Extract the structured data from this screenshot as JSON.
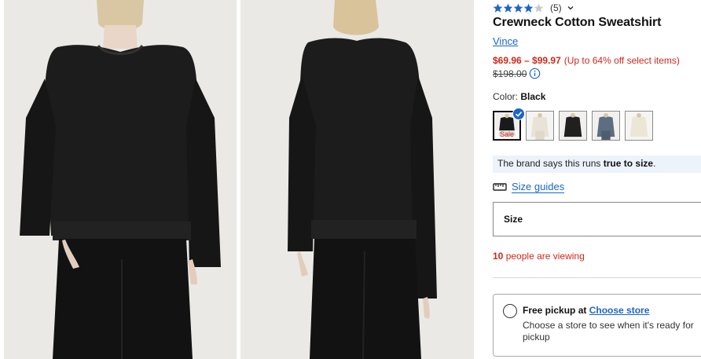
{
  "product": {
    "rating": 4,
    "review_count": "(5)",
    "title": "Crewneck Cotton Sweatshirt",
    "brand": "Vince",
    "price_range": "$69.96 – $99.97",
    "price_note": "(Up to 64% off select items)",
    "compare_price": "$198.00"
  },
  "color": {
    "label": "Color:",
    "selected": "Black",
    "swatches": [
      {
        "name": "Black",
        "hex": "#1a1a1a",
        "sale_label": "Sale"
      },
      {
        "name": "Ivory",
        "hex": "#e9e2d6"
      },
      {
        "name": "Black (alt)",
        "hex": "#202020"
      },
      {
        "name": "Blue Gray",
        "hex": "#5d6d82"
      },
      {
        "name": "Cream",
        "hex": "#ece6d5"
      }
    ]
  },
  "fit": {
    "prefix": "The brand says this runs",
    "emphasis": "true to size",
    "suffix": "."
  },
  "size_guides_label": "Size guides",
  "size_select_label": "Size",
  "viewing": {
    "count": "10",
    "text": "people are viewing"
  },
  "pickup": {
    "title": "Free pickup at",
    "link": "Choose store",
    "description": "Choose a store to see when it's ready for pickup"
  },
  "colors": {
    "accent_blue": "#1c65c7",
    "sale_red": "#d0281a",
    "fit_banner_bg": "#edf3fb"
  }
}
